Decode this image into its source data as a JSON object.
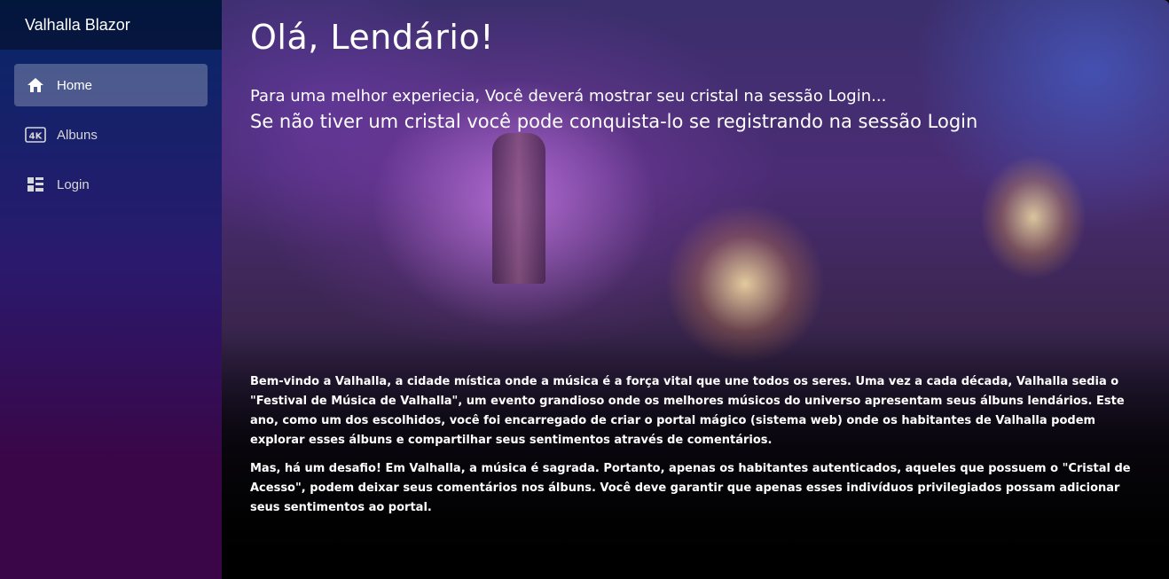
{
  "sidebar": {
    "brand": "Valhalla Blazor",
    "items": [
      {
        "label": "Home",
        "icon": "home-icon",
        "active": true
      },
      {
        "label": "Albuns",
        "icon": "4k-icon",
        "active": false
      },
      {
        "label": "Login",
        "icon": "dashboard-icon",
        "active": false
      }
    ]
  },
  "main": {
    "heading": "Olá, Lendário!",
    "intro_line1": "Para uma melhor experiecia, Você deverá mostrar seu cristal na sessão Login...",
    "intro_line2": "Se não tiver um cristal você pode conquista-lo se registrando na sessão Login",
    "paragraph1": "Bem-vindo a Valhalla, a cidade mística onde a música é a força vital que une todos os seres. Uma vez a cada década, Valhalla sedia o \"Festival de Música de Valhalla\", um evento grandioso onde os melhores músicos do universo apresentam seus álbuns lendários. Este ano, como um dos escolhidos, você foi encarregado de criar o portal mágico (sistema web) onde os habitantes de Valhalla podem explorar esses álbuns e compartilhar seus sentimentos através de comentários.",
    "paragraph2": "Mas, há um desafio! Em Valhalla, a música é sagrada. Portanto, apenas os habitantes autenticados, aqueles que possuem o \"Cristal de Acesso\", podem deixar seus comentários nos álbuns. Você deve garantir que apenas esses indivíduos privilegiados possam adicionar seus sentimentos ao portal."
  },
  "colors": {
    "sidebar_top": "#052767",
    "sidebar_bottom": "#3a0647",
    "active_item_bg": "rgba(255,255,255,0.25)"
  }
}
